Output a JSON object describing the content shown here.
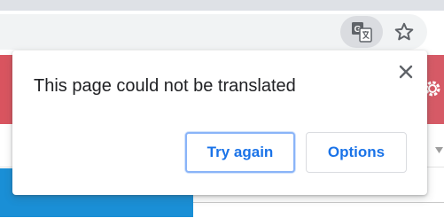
{
  "browser": {
    "translate_icon": "google-translate-icon",
    "bookmark_icon": "star-outline-icon"
  },
  "page": {
    "banner_color": "#e0646d",
    "settings_icon": "gear-icon"
  },
  "translate_popup": {
    "message": "This page could not be translated",
    "close_icon": "close-icon",
    "try_again_label": "Try again",
    "options_label": "Options",
    "accent_color": "#1a73e8"
  }
}
